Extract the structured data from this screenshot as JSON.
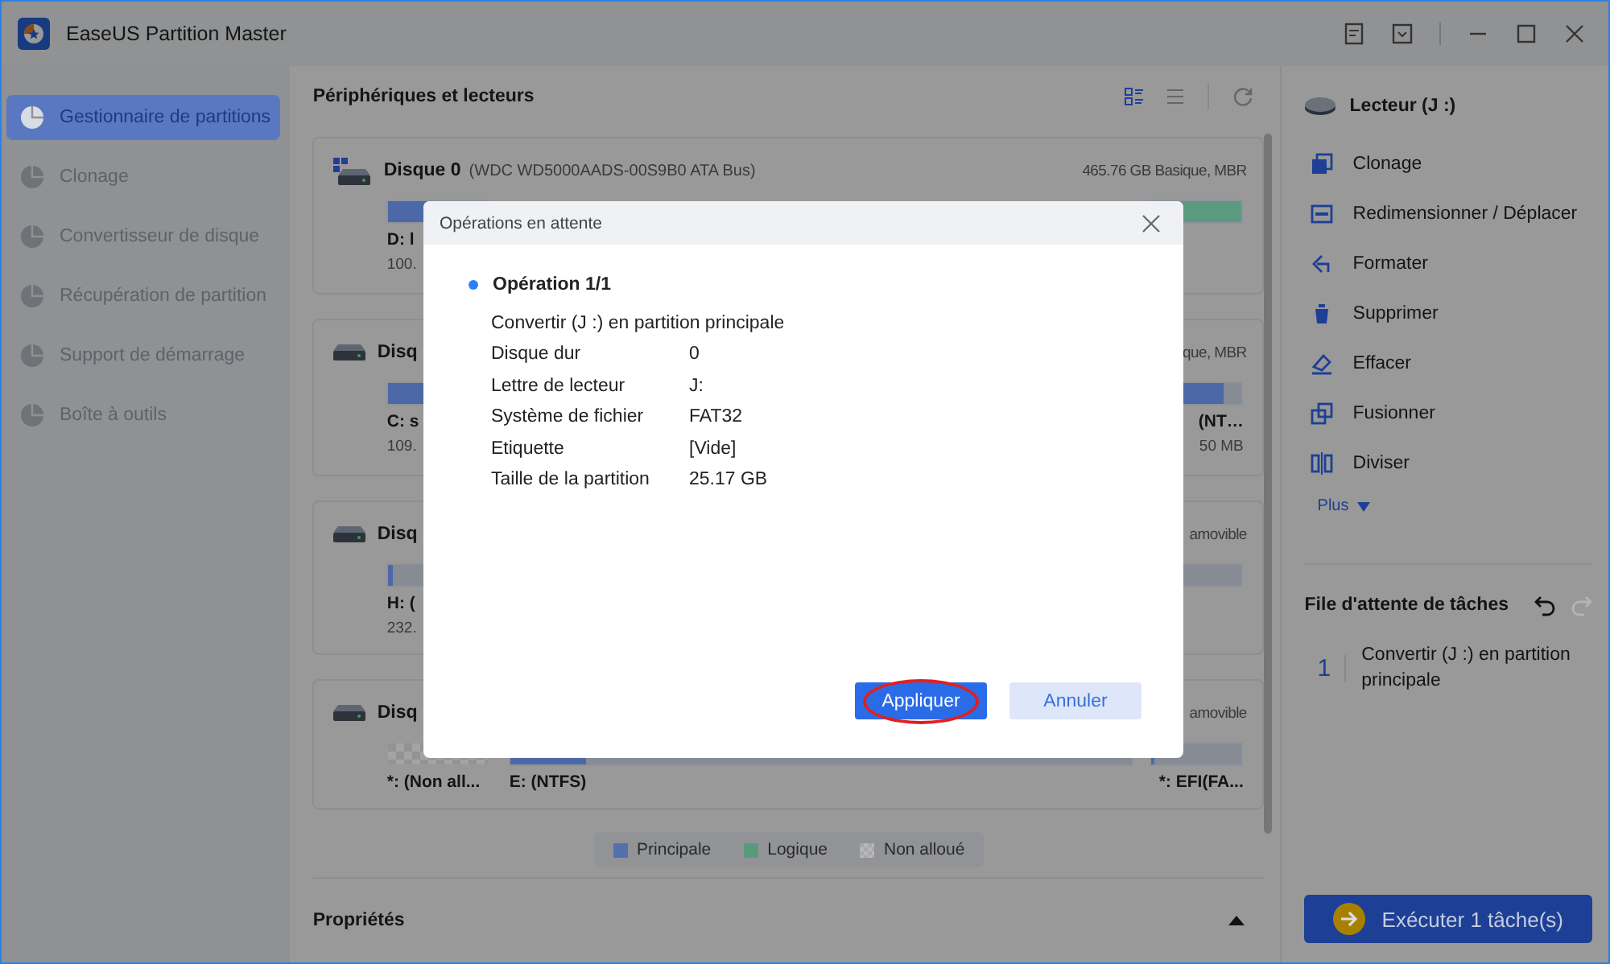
{
  "window": {
    "title": "EaseUS Partition Master"
  },
  "sidebar": {
    "items": [
      {
        "label": "Gestionnaire de partitions",
        "selected": true
      },
      {
        "label": "Clonage",
        "selected": false
      },
      {
        "label": "Convertisseur de disque",
        "selected": false
      },
      {
        "label": "Récupération de partition",
        "selected": false
      },
      {
        "label": "Support de démarrage",
        "selected": false
      },
      {
        "label": "Boîte à outils",
        "selected": false
      }
    ]
  },
  "devices": {
    "title": "Périphériques et lecteurs",
    "disks": [
      {
        "name": "Disque 0",
        "model": "(WDC WD5000AADS-00S9B0 ATA Bus)",
        "info": "465.76 GB Basique, MBR",
        "system": true,
        "partitions": [
          {
            "kind": "primary",
            "label": "D: l",
            "size": "100.",
            "level": 1
          },
          {
            "kind": "logical",
            "level": 1
          }
        ]
      },
      {
        "name": "Disq",
        "info": "que, MBR",
        "system": false,
        "partitions": [
          {
            "kind": "primary",
            "label": "C: s",
            "size": "109.",
            "level": 1
          },
          {
            "kind": "primary",
            "label": "(NT…",
            "size": "50 MB",
            "level": 0.8
          }
        ]
      },
      {
        "name": "Disq",
        "info": "amovible",
        "system": false,
        "partitions": [
          {
            "kind": "primary",
            "label": "H: (",
            "size": "232.",
            "level": 0.05
          },
          {
            "kind": "primary"
          }
        ]
      },
      {
        "name": "Disq",
        "info": "amovible",
        "system": false,
        "partitions": [
          {
            "kind": "unallocated",
            "label": "*: (Non all..."
          },
          {
            "kind": "primary",
            "label": "E: (NTFS)",
            "level": 0.12
          },
          {
            "kind": "primary",
            "label": "*: EFI(FA...",
            "level": 0.03
          }
        ]
      }
    ],
    "legend": [
      {
        "label": "Principale",
        "kind": "primary",
        "color": "#5070b0"
      },
      {
        "label": "Logique",
        "kind": "logical",
        "color": "#5a9a7c"
      },
      {
        "label": "Non alloué",
        "kind": "unallocated",
        "color": "#b8b8b8"
      }
    ]
  },
  "properties": {
    "title": "Propriétés",
    "expanded": true
  },
  "actions": {
    "drive": "Lecteur (J :)",
    "items": [
      "Clonage",
      "Redimensionner / Déplacer",
      "Formater",
      "Supprimer",
      "Effacer",
      "Fusionner",
      "Diviser"
    ],
    "more": "Plus"
  },
  "queue": {
    "title": "File d'attente de tâches",
    "redo_disabled": true,
    "tasks": [
      {
        "number": "1",
        "text": "Convertir (J :) en partition principale"
      }
    ],
    "execute": "Exécuter 1 tâche(s)"
  },
  "dialog": {
    "title": "Opérations en attente",
    "operation": "Opération 1/1",
    "description": "Convertir (J :) en partition principale",
    "details": [
      {
        "label": "Disque dur",
        "value": "0"
      },
      {
        "label": "Lettre de lecteur",
        "value": "J:"
      },
      {
        "label": "Système de fichier",
        "value": "FAT32"
      },
      {
        "label": "Etiquette",
        "value": "[Vide]"
      },
      {
        "label": "Taille de la partition",
        "value": "25.17 GB"
      }
    ],
    "apply": "Appliquer",
    "cancel": "Annuler",
    "apply_highlighted": true
  }
}
